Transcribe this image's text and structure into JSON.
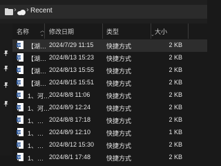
{
  "address": {
    "crumb": "Recent"
  },
  "columns": {
    "name": "名称",
    "date": "修改日期",
    "type": "类型",
    "size": "大小"
  },
  "rows": [
    {
      "name": "【湖…",
      "date": "2024/7/29 11:15",
      "type": "快捷方式",
      "size": "2 KB",
      "icon": "word-doc-icon",
      "selected": true
    },
    {
      "name": "【湖…",
      "date": "2024/8/13 15:23",
      "type": "快捷方式",
      "size": "2 KB",
      "icon": "word-doc-icon"
    },
    {
      "name": "【湖…",
      "date": "2024/8/13 15:55",
      "type": "快捷方式",
      "size": "2 KB",
      "icon": "word-doc-icon"
    },
    {
      "name": "【湖…",
      "date": "2024/8/15 15:51",
      "type": "快捷方式",
      "size": "2 KB",
      "icon": "word-doc-icon"
    },
    {
      "name": "1、河…",
      "date": "2024/8/8 11:06",
      "type": "快捷方式",
      "size": "2 KB",
      "icon": "word-doc-icon"
    },
    {
      "name": "1、河…",
      "date": "2024/8/9 12:24",
      "type": "快捷方式",
      "size": "2 KB",
      "icon": "word-doc-icon"
    },
    {
      "name": "1、…",
      "date": "2024/8/8 17:18",
      "type": "快捷方式",
      "size": "2 KB",
      "icon": "word-doc-icon"
    },
    {
      "name": "1、…",
      "date": "2024/8/9 12:10",
      "type": "快捷方式",
      "size": "1 KB",
      "icon": "word-doc-icon"
    },
    {
      "name": "1、…",
      "date": "2024/8/12 15:30",
      "type": "快捷方式",
      "size": "2 KB",
      "icon": "word-doc-icon"
    },
    {
      "name": "1、…",
      "date": "2024/8/1 17:48",
      "type": "快捷方式",
      "size": "2 KB",
      "icon": "word-doc-icon"
    }
  ],
  "colors": {
    "background": "#191919",
    "selected_row": "#2d2d2d",
    "word_blue": "#2b579a"
  }
}
